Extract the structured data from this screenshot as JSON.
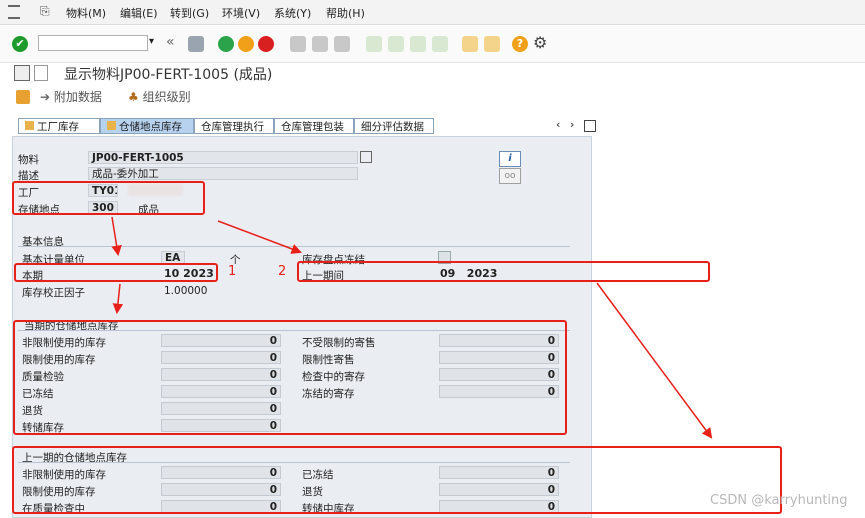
{
  "menu": {
    "items": [
      "物料(M)",
      "编辑(E)",
      "转到(G)",
      "环境(V)",
      "系统(Y)",
      "帮助(H)"
    ]
  },
  "toolbar": {
    "command_field": ""
  },
  "title": "显示物料JP00-FERT-1005 (成品)",
  "app_toolbar": {
    "additional_data": "附加数据",
    "org_levels": "组织级别"
  },
  "tabs": [
    "工厂库存",
    "仓储地点库存",
    "仓库管理执行",
    "仓库管理包装",
    "细分评估数据"
  ],
  "header": {
    "material_label": "物料",
    "material_value": "JP00-FERT-1005",
    "desc_label": "描述",
    "desc_value": "成品-委外加工",
    "plant_label": "工厂",
    "plant_value": "TY01",
    "sloc_label": "存储地点",
    "sloc_value": "300",
    "sloc_desc": "成品"
  },
  "basic": {
    "title": "基本信息",
    "uom_label": "基本计量单位",
    "uom_value": "EA",
    "uom_desc": "个",
    "phys_inv_label": "库存盘点冻结",
    "period_label": "本期",
    "period_value": "10 2023",
    "prev_period_label": "上一期间",
    "prev_period_value": "09   2023",
    "factor_label": "库存校正因子",
    "factor_value": "1.00000"
  },
  "current": {
    "title": "当期的仓储地点库存",
    "left": [
      {
        "label": "非限制使用的库存",
        "value": "0"
      },
      {
        "label": "限制使用的库存",
        "value": "0"
      },
      {
        "label": "质量检验",
        "value": "0"
      },
      {
        "label": "已冻结",
        "value": "0"
      },
      {
        "label": "退货",
        "value": "0"
      },
      {
        "label": "转储库存",
        "value": "0"
      }
    ],
    "right": [
      {
        "label": "不受限制的寄售",
        "value": "0"
      },
      {
        "label": "限制性寄售",
        "value": "0"
      },
      {
        "label": "检查中的寄存",
        "value": "0"
      },
      {
        "label": "冻结的寄存",
        "value": "0"
      }
    ]
  },
  "previous": {
    "title": "上一期的仓储地点库存",
    "left": [
      {
        "label": "非限制使用的库存",
        "value": "0"
      },
      {
        "label": "限制使用的库存",
        "value": "0"
      },
      {
        "label": "在质量检查中",
        "value": "0"
      }
    ],
    "right": [
      {
        "label": "已冻结",
        "value": "0"
      },
      {
        "label": "退货",
        "value": "0"
      },
      {
        "label": "转储中库存",
        "value": "0"
      }
    ]
  },
  "annotations": {
    "one": "1",
    "two": "2"
  },
  "watermark": "CSDN @karryhunting",
  "colors": {
    "accent_red": "#e8201a",
    "tab_active": "#b7d2ee",
    "panel_bg": "#eaeef3"
  }
}
